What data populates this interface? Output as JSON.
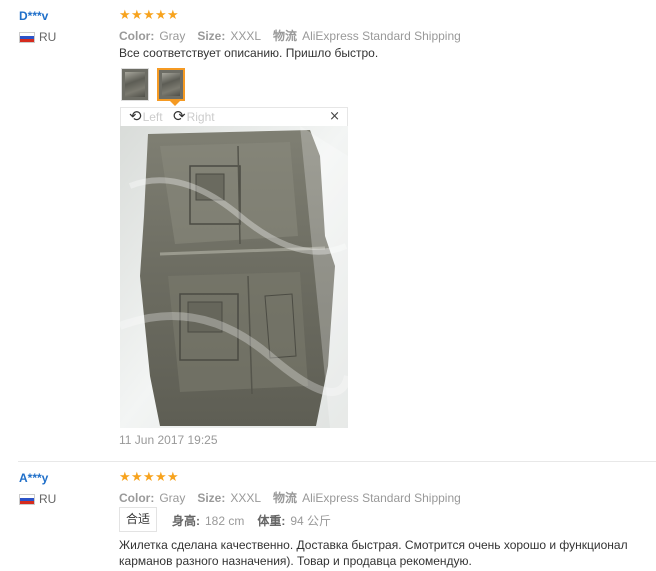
{
  "reviews": [
    {
      "user_name": "D***v",
      "country": "RU",
      "rating_stars": 5,
      "color_label": "Color:",
      "color_value": "Gray",
      "size_label": "Size:",
      "size_value": "XXXL",
      "shipping_label": "物流",
      "shipping_value": "AliExpress Standard Shipping",
      "feedback": "Все соответствует описанию. Пришло быстро.",
      "viewer": {
        "rotate_left": "Left",
        "rotate_right": "Right",
        "close": "×"
      },
      "date": "11 Jun 2017 19:25"
    },
    {
      "user_name": "A***y",
      "country": "RU",
      "rating_stars": 5,
      "color_label": "Color:",
      "color_value": "Gray",
      "size_label": "Size:",
      "size_value": "XXXL",
      "shipping_label": "物流",
      "shipping_value": "AliExpress Standard Shipping",
      "fit": "合适",
      "height_label": "身高:",
      "height_value": "182 cm",
      "weight_label": "体重:",
      "weight_value": "94 公斤",
      "feedback_line1": "Жилетка сделана качественно. Доставка быстрая. Смотрится очень хорошо и функционал",
      "feedback_line2": "карманов разного назначения). Товар и продавца рекомендую."
    }
  ],
  "colors": {
    "star": "#f7a31e",
    "user_link": "#1f6fc9",
    "active_thumb_border": "#f59a23"
  },
  "icons": {
    "star": "star-icon",
    "flag": "russia-flag-icon",
    "rotate_left": "rotate-left-icon",
    "rotate_right": "rotate-right-icon",
    "close": "close-icon"
  }
}
